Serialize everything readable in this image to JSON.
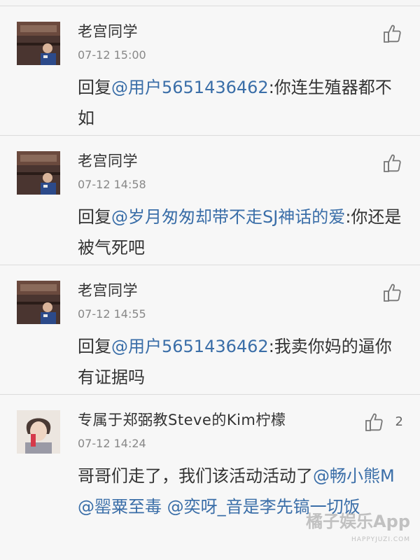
{
  "comments": [
    {
      "username": "老宫同学",
      "time": "07-12 15:00",
      "reply_prefix": "回复",
      "mention": "@用户5651436462",
      "text": ":你连生殖器都不如",
      "likes": ""
    },
    {
      "username": "老宫同学",
      "time": "07-12 14:58",
      "reply_prefix": "回复",
      "mention": "@岁月匆匆却带不走SJ神话的爱",
      "text": ":你还是被气死吧",
      "likes": ""
    },
    {
      "username": "老宫同学",
      "time": "07-12 14:55",
      "reply_prefix": "回复",
      "mention": "@用户5651436462",
      "text": ":我卖你妈的逼你有证据吗",
      "likes": ""
    },
    {
      "username": "专属于郑弼教Steve的Kim柠檬",
      "time": "07-12 14:24",
      "text_before": "哥哥们走了，我们该活动活动了",
      "mentions": [
        "@畅小熊M",
        "@罂粟至毒",
        "@奕呀_音是李先镐一切饭"
      ],
      "likes": "2"
    }
  ],
  "watermark": {
    "main": "橘子娱乐App",
    "sub": "HAPPYJUZI.COM"
  },
  "colors": {
    "mention": "#3a6ea8",
    "background": "#f7f7f7",
    "divider": "#dcdcdc"
  },
  "icons": {
    "like": "thumbs-up-icon"
  }
}
